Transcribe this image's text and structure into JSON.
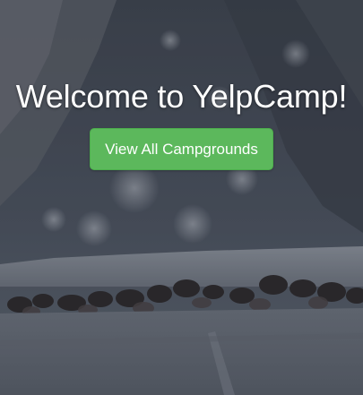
{
  "hero": {
    "title": "Welcome to YelpCamp!",
    "cta_label": "View All Campgrounds"
  },
  "colors": {
    "cta_background": "#5cb85c",
    "cta_border": "#4cae4c",
    "text": "#ffffff"
  }
}
